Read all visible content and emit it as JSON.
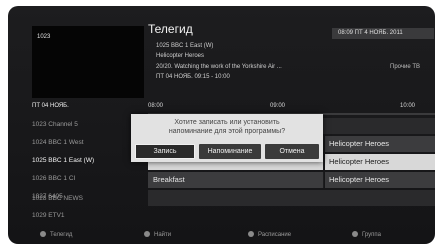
{
  "preview": {
    "channel_number": "1023"
  },
  "header": {
    "title": "Телегид",
    "clock": "08:09  ПТ 4 НОЯБ. 2011",
    "channel_line": "1025 BBC 1 East (W)",
    "program_title": "Helicopter Heroes",
    "genre": "Прочие ТВ",
    "description": "20/20. Watching the work of the Yorkshire Air ...",
    "schedule": "ПТ 04 НОЯБ. 09:15 - 10:00"
  },
  "grid": {
    "date": "ПТ 04 НОЯБ.",
    "times": [
      "08:00",
      "09:00",
      "10:00"
    ],
    "channels": [
      {
        "label": "1023  Channel 5",
        "programs": []
      },
      {
        "label": "1024  BBC 1 West",
        "programs": [
          "",
          "Helicopter Heroes"
        ]
      },
      {
        "label": "1025  BBC 1 East (W)",
        "programs": [
          "",
          "Helicopter Heroes"
        ],
        "selected": true
      },
      {
        "label": "1026  BBC 1 CI",
        "programs": [
          "Breakfast",
          "Helicopter Heroes"
        ]
      },
      {
        "label": "1027  6405",
        "programs": []
      },
      {
        "label": "1028  BBC NEWS",
        "programs": []
      },
      {
        "label": "1029  ETV1",
        "programs": []
      }
    ]
  },
  "dialog": {
    "line1": "Хотите записать или установить",
    "line2": "напоминание для этой программы?",
    "record_label": "Запись",
    "reminder_label": "Напоминание",
    "cancel_label": "Отмена"
  },
  "footer": {
    "items": [
      {
        "label": "Телегид",
        "icon": "red-dot-icon"
      },
      {
        "label": "Найти",
        "icon": "green-dot-icon"
      },
      {
        "label": "Расписание",
        "icon": "yellow-dot-icon"
      },
      {
        "label": "Группа",
        "icon": "blue-dot-icon"
      }
    ]
  },
  "colors": {
    "background": "#1d1d1f",
    "selected_row": "#d8d8d8",
    "dialog": "#e2e2e2"
  }
}
